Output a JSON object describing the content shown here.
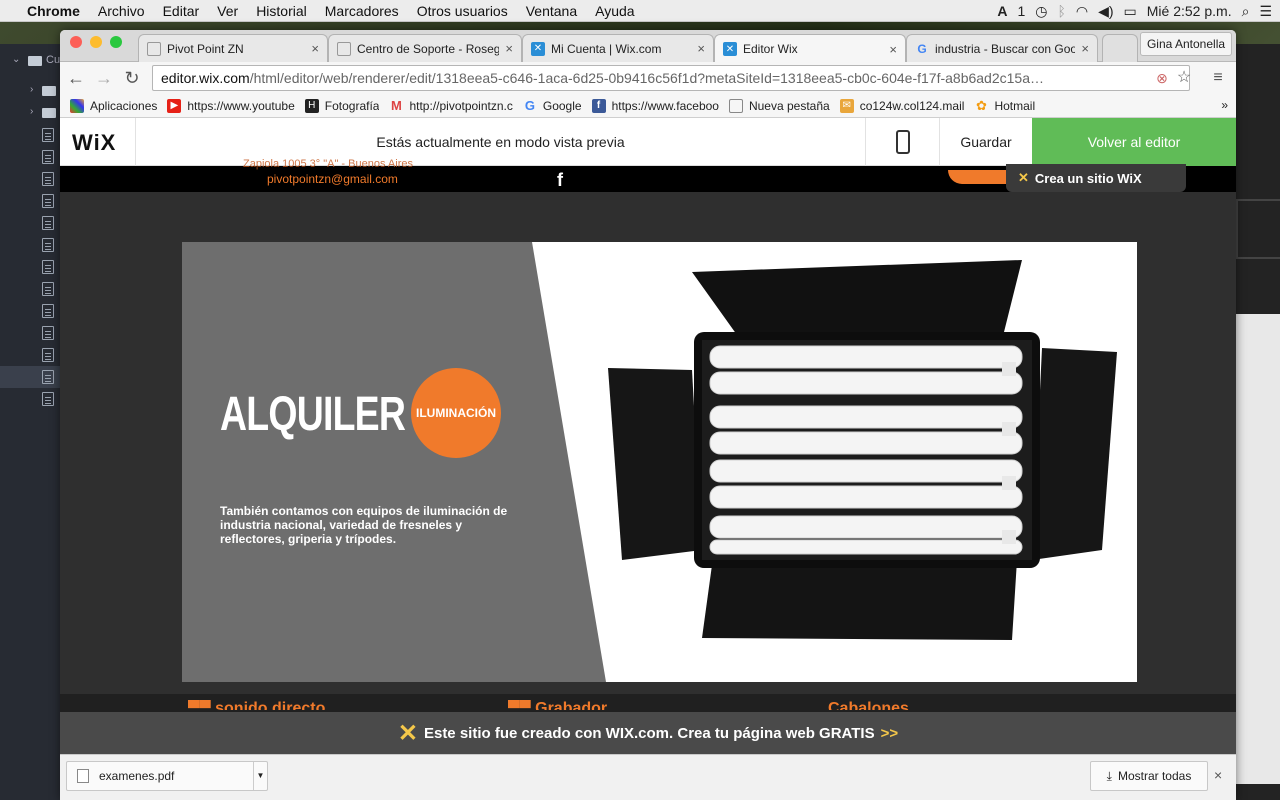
{
  "menubar": {
    "apple": "",
    "items": [
      "Chrome",
      "Archivo",
      "Editar",
      "Ver",
      "Historial",
      "Marcadores",
      "Otros usuarios",
      "Ventana",
      "Ayuda"
    ],
    "status_num": "1",
    "clock": "Mié 2:52 p.m."
  },
  "sidepanel": {
    "folder_label": "Cu"
  },
  "browser": {
    "tabs": [
      {
        "title": "Pivot Point ZN",
        "icon": "page-icon"
      },
      {
        "title": "Centro de Soporte - Roseg",
        "icon": "page-icon"
      },
      {
        "title": "Mi Cuenta | Wix.com",
        "icon": "wix-icon"
      },
      {
        "title": "Editor Wix",
        "icon": "wix-icon",
        "active": true
      },
      {
        "title": "industria - Buscar con Goo",
        "icon": "google-icon"
      }
    ],
    "profile": "Gina Antonella",
    "url_host": "editor.wix.com",
    "url_path": "/html/editor/web/renderer/edit/1318eea5-c646-1aca-6d25-0b9416c56f1d?metaSiteId=1318eea5-cb0c-604e-f17f-a8b6ad2c15a…",
    "bookmarks": [
      {
        "label": "Aplicaciones",
        "icon": "apps-icon"
      },
      {
        "label": "https://www.youtube",
        "icon": "youtube-icon"
      },
      {
        "label": "Fotografía",
        "icon": "photo-icon"
      },
      {
        "label": "http://pivotpointzn.c",
        "icon": "gmail-icon"
      },
      {
        "label": "Google",
        "icon": "google-icon"
      },
      {
        "label": "https://www.faceboo",
        "icon": "facebook-icon"
      },
      {
        "label": "Nueva pestaña",
        "icon": "page-icon"
      },
      {
        "label": "co124w.col124.mail",
        "icon": "mail-icon"
      },
      {
        "label": "Hotmail",
        "icon": "hotmail-icon"
      }
    ],
    "bookmarks_more": "»"
  },
  "wix_preview": {
    "logo": "WiX",
    "message": "Estás actualmente en modo vista previa",
    "save": "Guardar",
    "back": "Volver al editor"
  },
  "site": {
    "address": "Zapiola 1005 3° \"A\" - Buenos Aires",
    "email": "pivotpointzn@gmail.com",
    "fb": "f",
    "create_site": "Crea un sitio WiX",
    "slide_title": "ALQUILER",
    "slide_badge": "ILUMINACIÓN",
    "slide_desc": "También contamos con equipos de iluminación de industria nacional, variedad de fresneles y reflectores, griperia y trípodes.",
    "lower_titles": [
      "▀▀ sonido directo",
      "▀▀ Grabador",
      "Cabalones"
    ],
    "banner_text": "Este sitio fue creado con WIX.com. Crea tu página web GRATIS",
    "banner_arrows": ">>"
  },
  "downloads": {
    "file": "examenes.pdf",
    "show_all": "Mostrar todas",
    "close": "×"
  },
  "colors": {
    "accent": "#f07a2b",
    "wix_green": "#60bc57"
  }
}
